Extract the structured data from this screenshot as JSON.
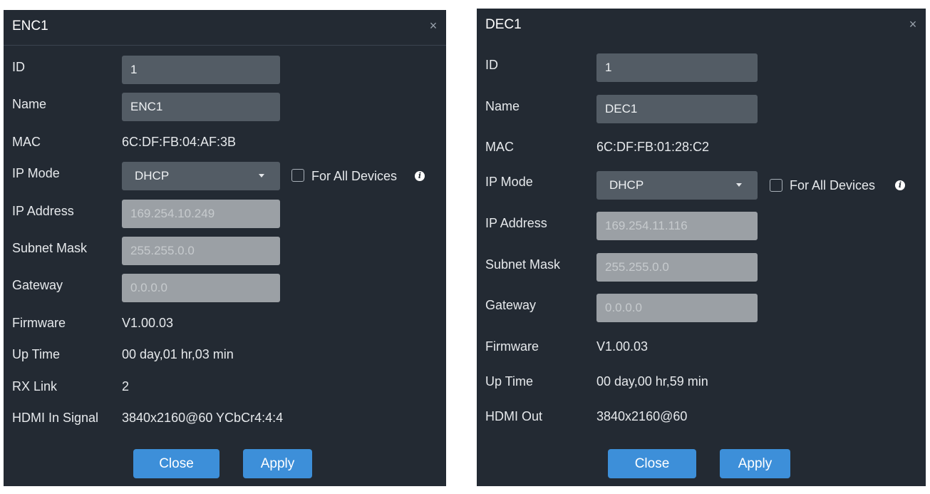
{
  "enc": {
    "title": "ENC1",
    "close_glyph": "×",
    "labels": {
      "id": "ID",
      "name": "Name",
      "mac": "MAC",
      "ip_mode": "IP Mode",
      "ip_address": "IP Address",
      "subnet_mask": "Subnet Mask",
      "gateway": "Gateway",
      "firmware": "Firmware",
      "up_time": "Up Time",
      "rx_link": "RX Link",
      "hdmi": "HDMI In Signal"
    },
    "values": {
      "id": "1",
      "name": "ENC1",
      "mac": "6C:DF:FB:04:AF:3B",
      "ip_mode": "DHCP",
      "ip_address": "169.254.10.249",
      "subnet_mask": "255.255.0.0",
      "gateway": "0.0.0.0",
      "firmware": "V1.00.03",
      "up_time": "00 day,01 hr,03 min",
      "rx_link": "2",
      "hdmi": "3840x2160@60 YCbCr4:4:4"
    },
    "for_all_devices": "For All Devices",
    "buttons": {
      "close": "Close",
      "apply": "Apply"
    }
  },
  "dec": {
    "title": "DEC1",
    "close_glyph": "×",
    "labels": {
      "id": "ID",
      "name": "Name",
      "mac": "MAC",
      "ip_mode": "IP Mode",
      "ip_address": "IP Address",
      "subnet_mask": "Subnet Mask",
      "gateway": "Gateway",
      "firmware": "Firmware",
      "up_time": "Up Time",
      "hdmi": "HDMI Out"
    },
    "values": {
      "id": "1",
      "name": "DEC1",
      "mac": "6C:DF:FB:01:28:C2",
      "ip_mode": "DHCP",
      "ip_address": "169.254.11.116",
      "subnet_mask": "255.255.0.0",
      "gateway": "0.0.0.0",
      "firmware": "V1.00.03",
      "up_time": "00 day,00 hr,59 min",
      "hdmi": "3840x2160@60"
    },
    "for_all_devices": "For All Devices",
    "buttons": {
      "close": "Close",
      "apply": "Apply"
    }
  },
  "icons": {
    "info": "i",
    "close": "close-icon",
    "dropdown": "caret-down-icon"
  },
  "colors": {
    "dialog_bg": "#232a33",
    "accent": "#3d8fd9",
    "input_bg": "#535c65",
    "input_disabled_bg": "#9ba0a5"
  }
}
